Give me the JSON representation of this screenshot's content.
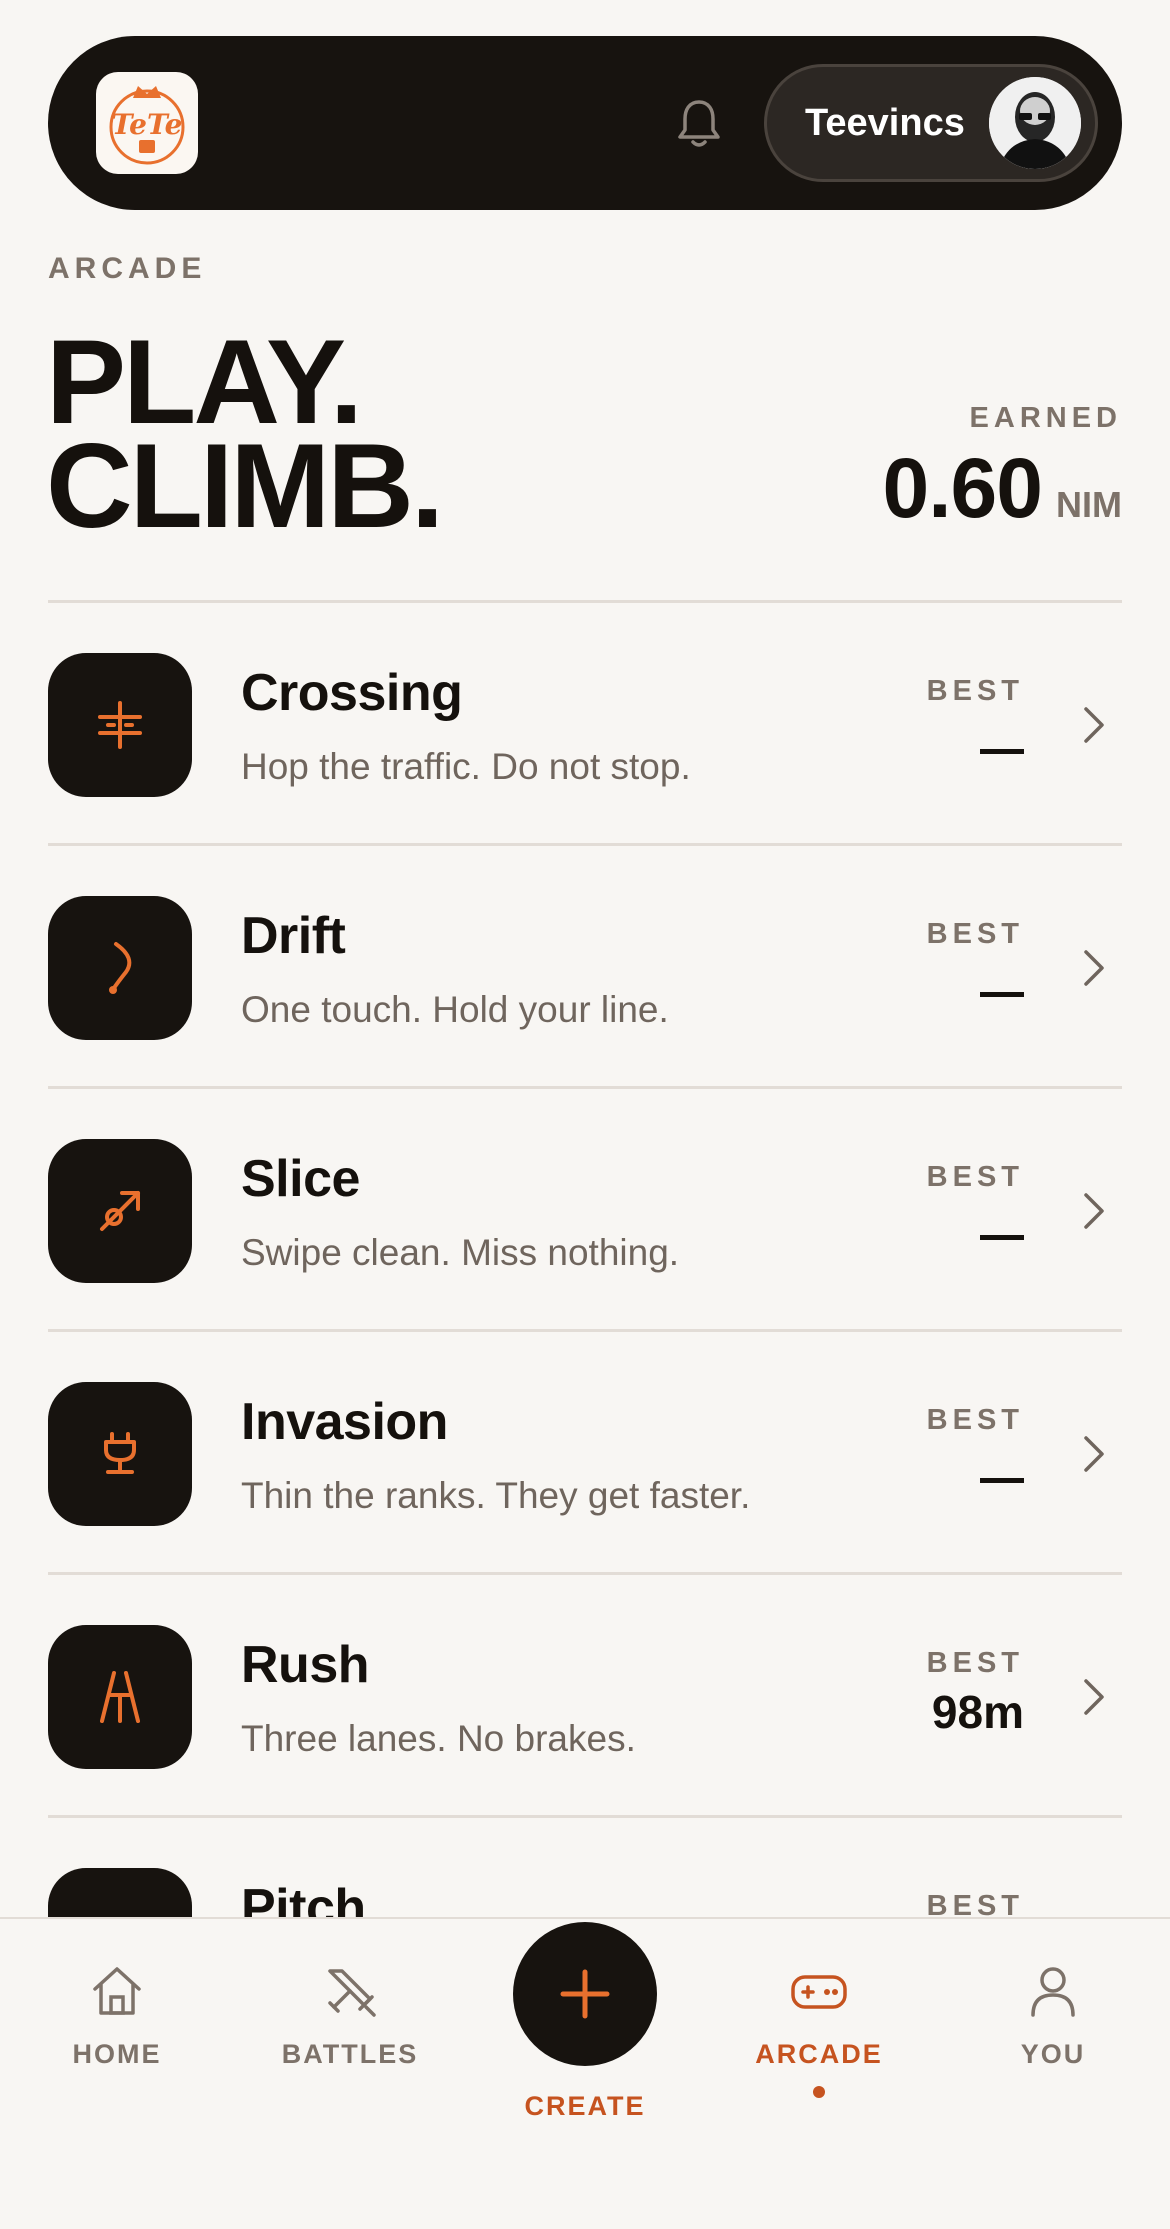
{
  "header": {
    "logo_text": "TeTe",
    "username": "Teevincs"
  },
  "hero": {
    "eyebrow": "ARCADE",
    "title_line1": "PLAY.",
    "title_line2": "CLIMB.",
    "earned_label": "EARNED",
    "earned_value": "0.60",
    "earned_unit": "NIM"
  },
  "games": [
    {
      "name": "Crossing",
      "desc": "Hop the traffic. Do not stop.",
      "best_label": "BEST",
      "best": "—",
      "icon": "crossing-icon"
    },
    {
      "name": "Drift",
      "desc": "One touch. Hold your line.",
      "best_label": "BEST",
      "best": "—",
      "icon": "drift-icon"
    },
    {
      "name": "Slice",
      "desc": "Swipe clean. Miss nothing.",
      "best_label": "BEST",
      "best": "—",
      "icon": "slice-icon"
    },
    {
      "name": "Invasion",
      "desc": "Thin the ranks. They get faster.",
      "best_label": "BEST",
      "best": "—",
      "icon": "invasion-icon"
    },
    {
      "name": "Rush",
      "desc": "Three lanes. No brakes.",
      "best_label": "BEST",
      "best": "98m",
      "icon": "rush-icon"
    },
    {
      "name": "Pitch",
      "desc": "",
      "best_label": "BEST",
      "best": "",
      "icon": "pitch-icon"
    }
  ],
  "nav": {
    "home": "HOME",
    "battles": "BATTLES",
    "create": "CREATE",
    "arcade": "ARCADE",
    "you": "YOU"
  },
  "colors": {
    "accent": "#e8702e",
    "active_nav": "#c6531f",
    "dark": "#17130f",
    "background": "#f8f6f3",
    "muted": "#7d7269"
  }
}
